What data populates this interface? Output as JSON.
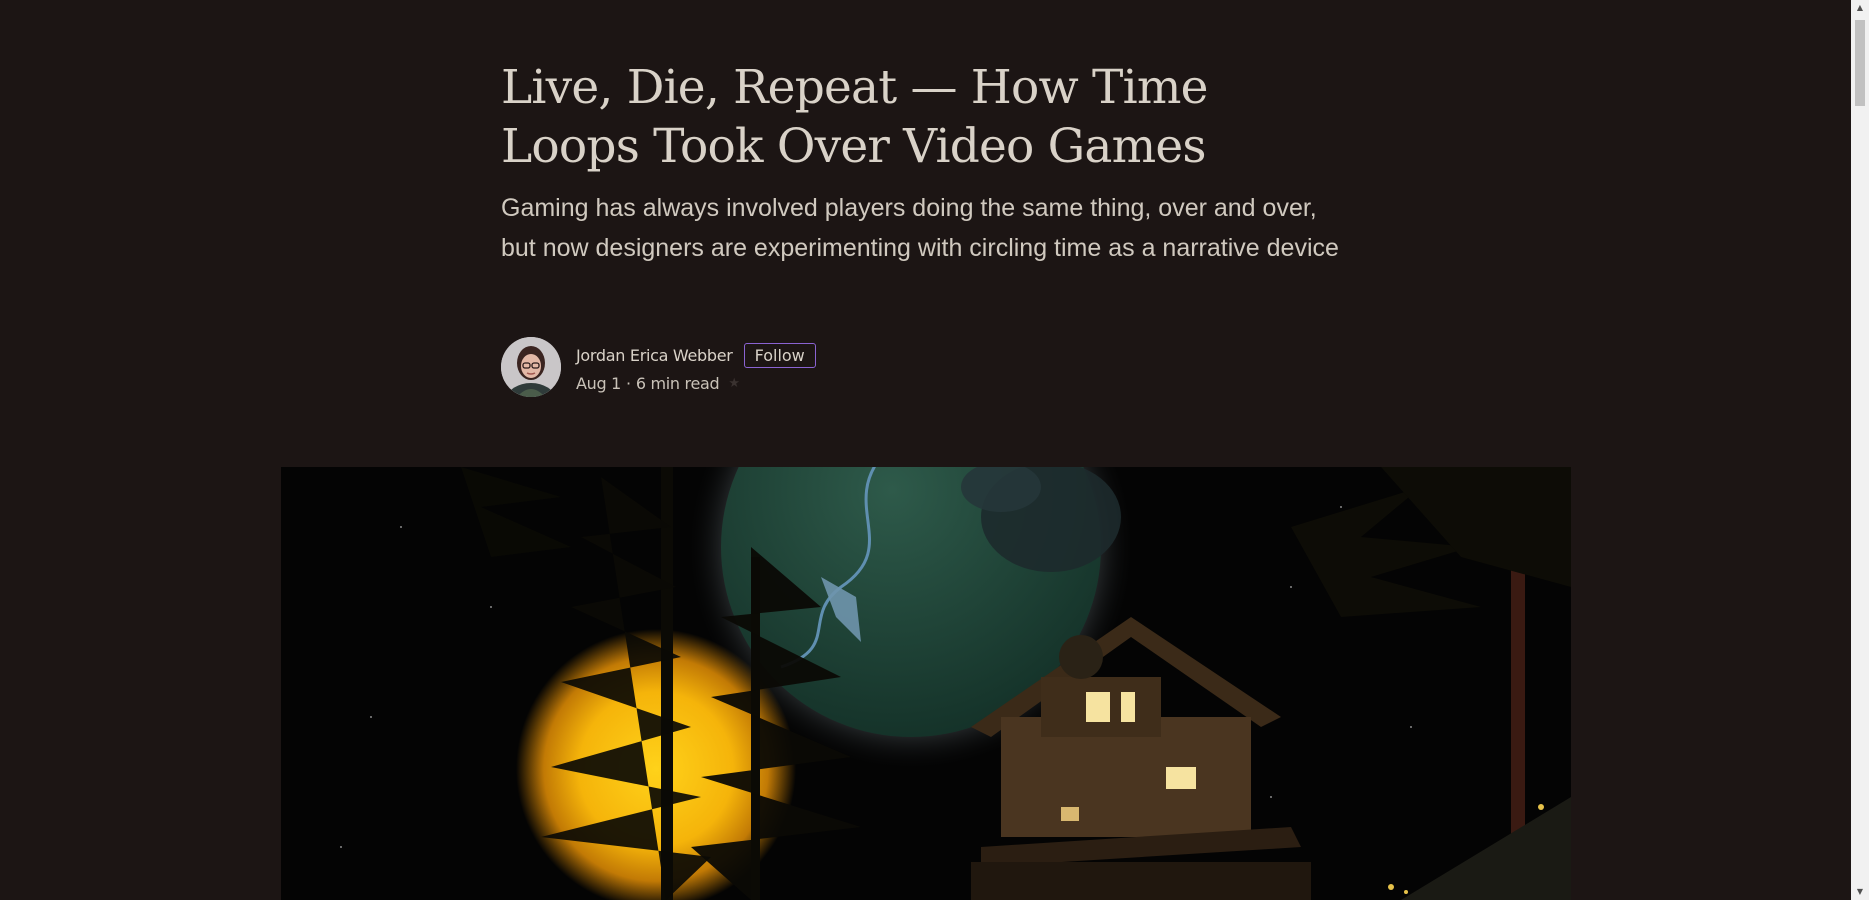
{
  "article": {
    "title": "Live, Die, Repeat — How Time Loops Took Over Video Games",
    "subtitle": "Gaming has always involved players doing the same thing, over and over, but now designers are experimenting with circling time as a narrative device"
  },
  "byline": {
    "author_name": "Jordan Erica Webber",
    "follow_label": "Follow",
    "date": "Aug 1",
    "separator": "·",
    "read_time": "6 min read",
    "star_glyph": "★"
  },
  "hero_image": {
    "alt": "Night scene with glowing sun, pine trees, a planet and a wooden observatory"
  },
  "scrollbar": {
    "up_glyph": "▲",
    "down_glyph": "▼"
  },
  "colors": {
    "background": "#1c1514",
    "text": "#d9d2c8",
    "follow_border": "#8a63d2"
  }
}
